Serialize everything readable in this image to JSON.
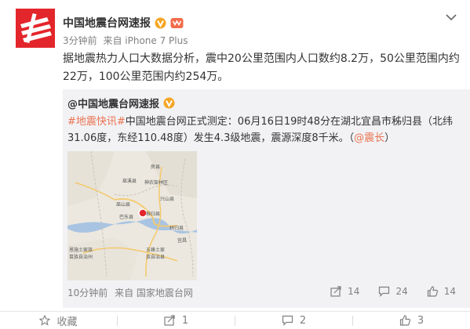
{
  "post": {
    "author": "中国地震台网速报",
    "time": "3分钟前",
    "source": "来自 iPhone 7 Plus",
    "text": "据地震热力人口大数据分析，震中20公里范围内人口数约8.2万，50公里范围内约22万，100公里范围内约254万。"
  },
  "repost": {
    "author": "@中国地震台网速报",
    "hashtag": "#地震快讯#",
    "body": "中国地震台网正式测定：06月16日19时48分在湖北宜昌市秭归县（北纬31.06度，东经110.48度）发生4.3级地震，震源深度8千米。（",
    "mention": "@震长",
    "body_end": "）",
    "time": "10分钟前",
    "source": "来自 国家地震台网",
    "reposts": "14",
    "comments": "24",
    "likes": "14"
  },
  "map": {
    "labels": [
      "房县",
      "神农架林区",
      "兴山县",
      "巫山县",
      "巴东县",
      "秭归县",
      "林归县",
      "恩施土家族",
      "苗族自治州",
      "五峰土家",
      "族自治县",
      "巫溪县",
      "宜昌"
    ]
  },
  "actions": {
    "favorite": "收藏",
    "repost": "1",
    "comment": "2",
    "like": "3"
  },
  "colors": {
    "brand_red": "#e3262b",
    "link": "#eb7350",
    "verified": "#f5a623"
  }
}
